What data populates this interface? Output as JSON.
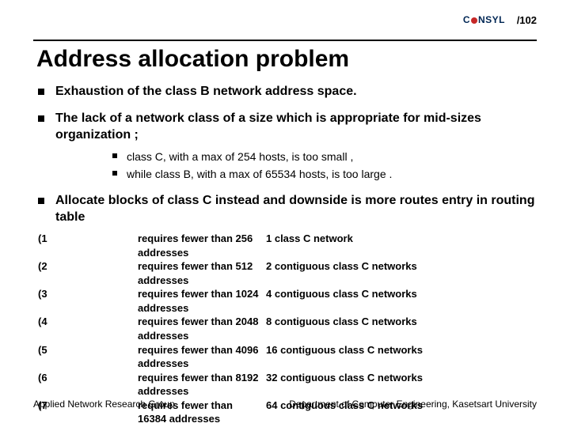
{
  "brand": {
    "left": "C",
    "right": "NSYL"
  },
  "page_number": "/102",
  "title": "Address allocation problem",
  "bullets": {
    "b1": "Exhaustion of the class B network address space.",
    "b2": "The lack of a network class of a size which is appropriate for mid-sizes organization ;",
    "b2_sub1": "class C, with a max of 254 hosts, is too small ,",
    "b2_sub2": "while class B, with a max of 65534 hosts, is too large .",
    "b3": "Allocate blocks of class C instead and downside is more routes entry in routing table"
  },
  "table": [
    {
      "idx": "(1",
      "req": "requires fewer than 256 addresses",
      "alloc": "1 class C network"
    },
    {
      "idx": "(2",
      "req": "requires fewer than 512 addresses",
      "alloc": "2 contiguous class C networks"
    },
    {
      "idx": "(3",
      "req": "requires fewer than 1024 addresses",
      "alloc": "4 contiguous class C networks"
    },
    {
      "idx": "(4",
      "req": "requires fewer than 2048 addresses",
      "alloc": "8 contiguous class C networks"
    },
    {
      "idx": "(5",
      "req": "requires fewer than 4096 addresses",
      "alloc": "16 contiguous class C networks"
    },
    {
      "idx": "(6",
      "req": "requires fewer than 8192 addresses",
      "alloc": "32 contiguous class C networks"
    },
    {
      "idx": "(7",
      "req": "requires fewer than 16384 addresses",
      "alloc": "64 contiguous class C networks"
    }
  ],
  "footer": {
    "left": "Applied Network Research Group",
    "right": "Department of Computer Engineering, Kasetsart University"
  }
}
